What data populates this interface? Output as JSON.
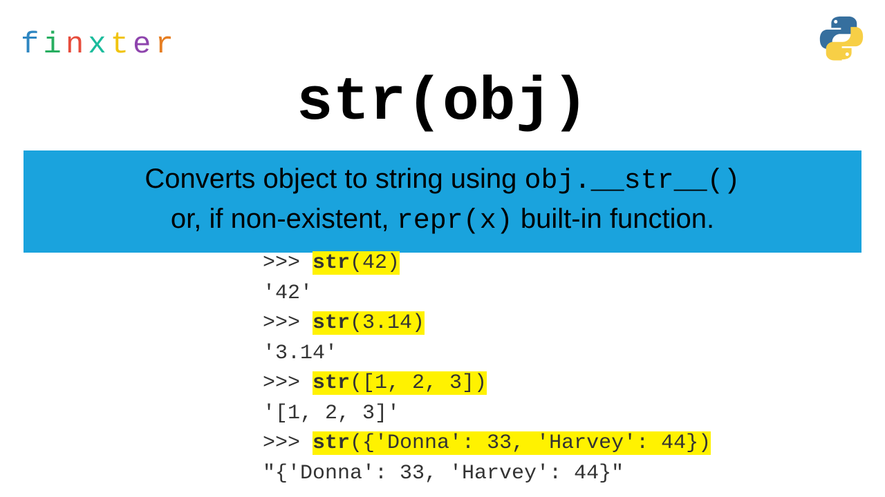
{
  "logo": {
    "letters": [
      {
        "ch": "f",
        "color": "#2e86c1"
      },
      {
        "ch": "i",
        "color": "#27ae60"
      },
      {
        "ch": "n",
        "color": "#e74c3c"
      },
      {
        "ch": "x",
        "color": "#1abc9c"
      },
      {
        "ch": "t",
        "color": "#f1c40f"
      },
      {
        "ch": "e",
        "color": "#8e44ad"
      },
      {
        "ch": "r",
        "color": "#e67e22"
      }
    ]
  },
  "title": "str(obj)",
  "desc": {
    "prefix": "Converts object to string using ",
    "mono1": "obj.__str__()",
    "middle": " or, if non-existent, ",
    "mono2": "repr(x)",
    "suffix": " built-in function."
  },
  "code": [
    {
      "prompt": ">>> ",
      "fn": "str",
      "args": "(42)",
      "hl": true
    },
    {
      "out": "'42'"
    },
    {
      "prompt": ">>> ",
      "fn": "str",
      "args": "(3.14)",
      "hl": true
    },
    {
      "out": "'3.14'"
    },
    {
      "prompt": ">>> ",
      "fn": "str",
      "args": "([1, 2, 3])",
      "hl": true
    },
    {
      "out": "'[1, 2, 3]'"
    },
    {
      "prompt": ">>> ",
      "fn": "str",
      "args": "({'Donna': 33, 'Harvey': 44})",
      "hl": true
    },
    {
      "out": "\"{'Donna': 33, 'Harvey': 44}\""
    }
  ]
}
